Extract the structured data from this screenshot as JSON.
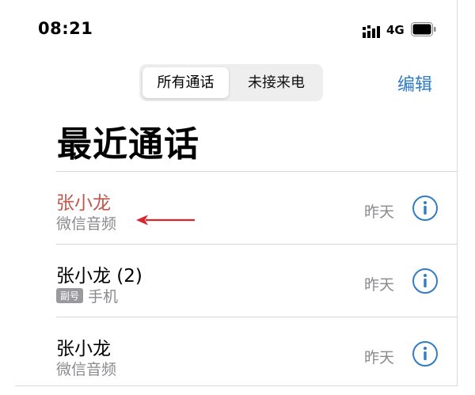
{
  "status_bar": {
    "time": "08:21",
    "network": "4G",
    "signal_icon": "cellular-signal-icon",
    "battery_icon": "battery-icon"
  },
  "segmented_control": {
    "options": [
      "所有通话",
      "未接来电"
    ],
    "selected": "所有通话"
  },
  "nav": {
    "edit_label": "编辑"
  },
  "page": {
    "title": "最近通话"
  },
  "calls": [
    {
      "name": "张小龙",
      "detail": "微信音频",
      "badge": "",
      "date": "昨天",
      "missed": true
    },
    {
      "name": "张小龙 (2)",
      "detail": "手机",
      "badge": "副号",
      "date": "昨天",
      "missed": false
    },
    {
      "name": "张小龙",
      "detail": "微信音频",
      "badge": "",
      "date": "昨天",
      "missed": false
    }
  ],
  "colors": {
    "accent": "#2f7cc8",
    "missed": "#c0574a",
    "secondary_text": "#8a8a8e",
    "arrow": "#d8262c"
  },
  "annotation": {
    "icon": "red-arrow-annotation-icon"
  }
}
